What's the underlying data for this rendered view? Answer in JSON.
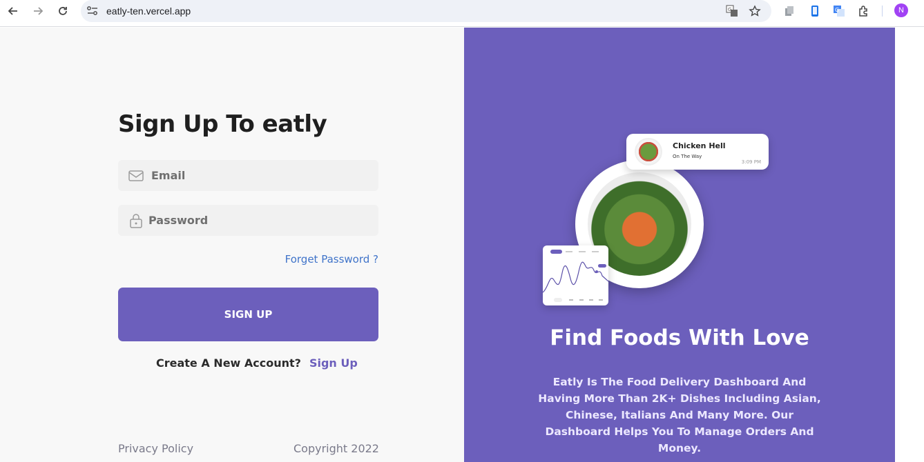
{
  "browser": {
    "url": "eatly-ten.vercel.app",
    "profile_initial": "N",
    "icons": [
      "back-icon",
      "forward-icon",
      "reload-icon",
      "site-info-icon",
      "translate-icon",
      "bookmark-star-icon",
      "extension-icon",
      "extension-icon",
      "google-translate-icon",
      "puzzle-icon"
    ]
  },
  "form": {
    "title": "Sign Up To eatly",
    "email_placeholder": "Email",
    "password_placeholder": "Password",
    "forget_label": "Forget Password ?",
    "submit_label": "SIGN UP",
    "create_text": "Create A New Account?",
    "create_link": "Sign Up"
  },
  "footer": {
    "privacy": "Privacy Policy",
    "copyright": "Copyright 2022"
  },
  "promo": {
    "notification": {
      "title": "Chicken Hell",
      "status": "On The Way",
      "time": "3:09 PM"
    },
    "heading": "Find Foods With Love",
    "description": "Eatly Is The Food Delivery Dashboard And Having More Than 2K+ Dishes Including Asian, Chinese, Italians And Many More. Our Dashboard Helps You To Manage Orders And Money."
  },
  "colors": {
    "brand": "#6c5fbc",
    "link": "#3f73c9",
    "background": "#f8f8f8"
  }
}
